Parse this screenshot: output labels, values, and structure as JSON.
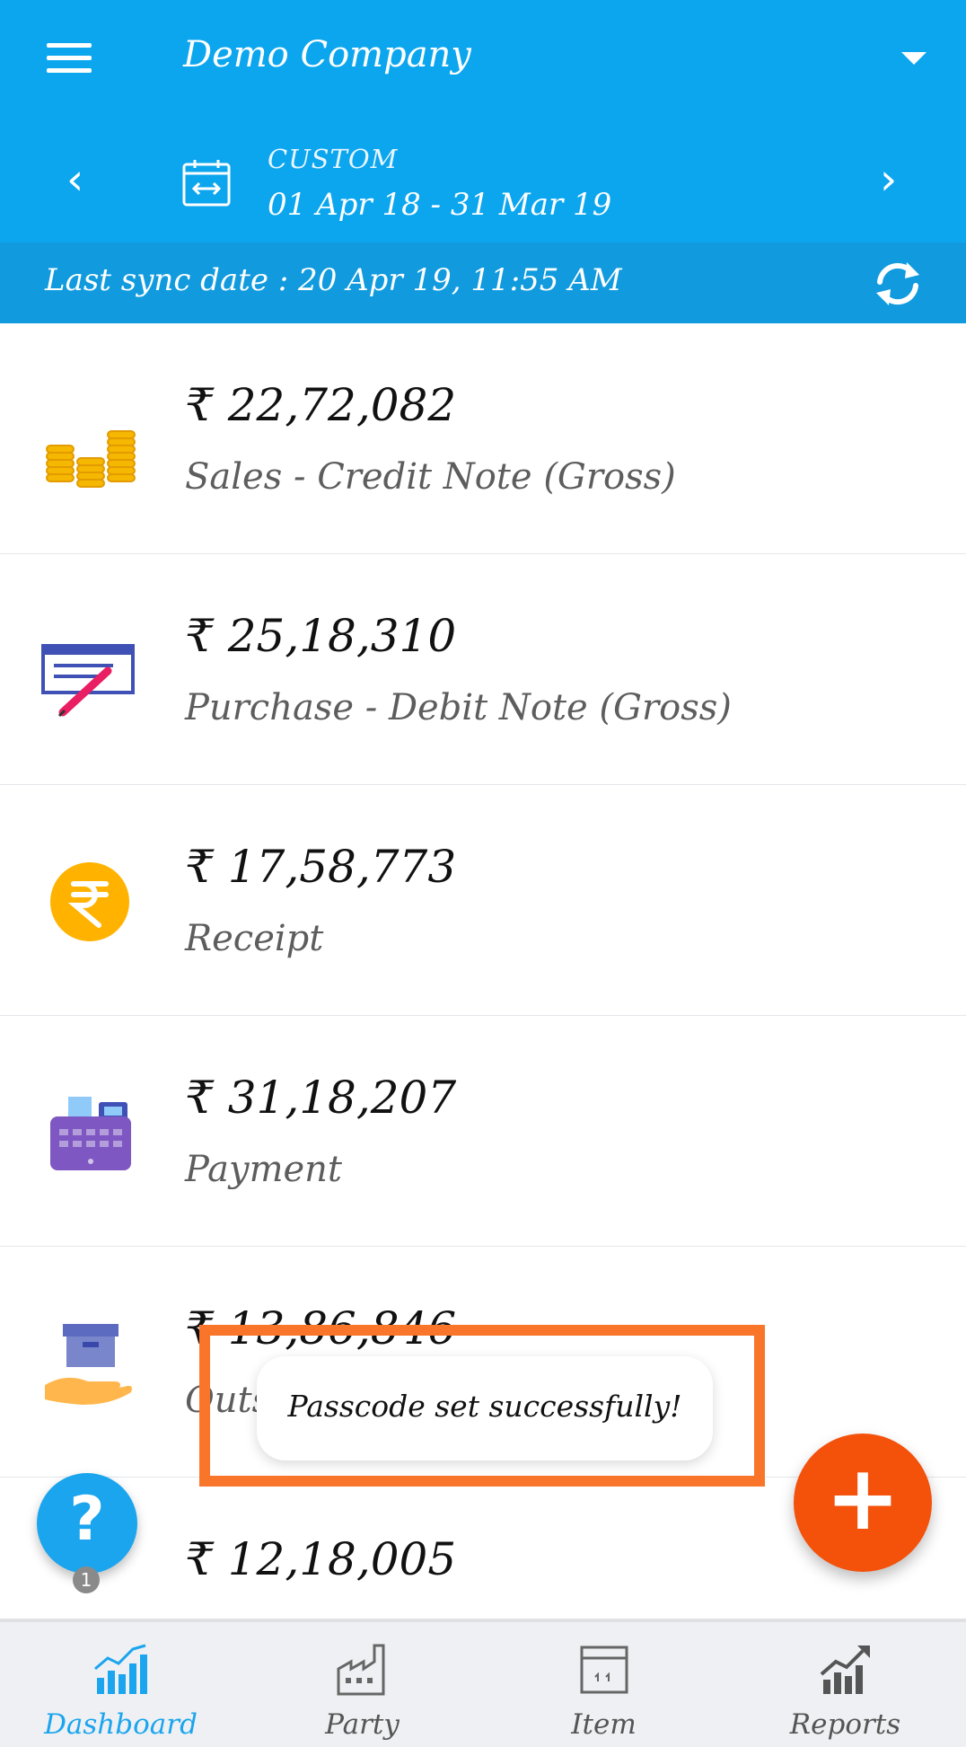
{
  "header": {
    "company_name": "Demo Company",
    "period_label": "CUSTOM",
    "period_range": "01 Apr 18 - 31 Mar 19",
    "prev_glyph": "‹",
    "next_glyph": "›"
  },
  "sync": {
    "text": "Last sync date : 20 Apr 19, 11:55 AM"
  },
  "rows": [
    {
      "amount": "₹ 22,72,082",
      "label": "Sales - Credit Note (Gross)",
      "icon": "coins-stack-icon"
    },
    {
      "amount": "₹ 25,18,310",
      "label": "Purchase - Debit Note (Gross)",
      "icon": "cheque-pen-icon"
    },
    {
      "amount": "₹ 17,58,773",
      "label": "Receipt",
      "icon": "rupee-coin-icon"
    },
    {
      "amount": "₹ 31,18,207",
      "label": "Payment",
      "icon": "cash-register-icon"
    },
    {
      "amount": "₹ 13,86,846",
      "label": "Outst",
      "icon": "box-on-hand-icon"
    },
    {
      "amount": "₹ 12,18,005",
      "label": "",
      "icon": "hand-icon"
    }
  ],
  "toast": {
    "message": "Passcode set successfully!"
  },
  "help_fab": {
    "glyph": "?"
  },
  "add_fab": {
    "glyph": "+"
  },
  "help_badge": "1",
  "bottom_nav": [
    {
      "label": "Dashboard",
      "icon": "dashboard-chart-icon",
      "active": true
    },
    {
      "label": "Party",
      "icon": "factory-icon",
      "active": false
    },
    {
      "label": "Item",
      "icon": "box-icon",
      "active": false
    },
    {
      "label": "Reports",
      "icon": "reports-chart-icon",
      "active": false
    }
  ],
  "colors": {
    "header_blue": "#0ca6ee",
    "sync_blue": "#119bde",
    "accent_orange": "#f4510b",
    "highlight_orange": "#f97529",
    "active_tab": "#1aa5ee"
  }
}
